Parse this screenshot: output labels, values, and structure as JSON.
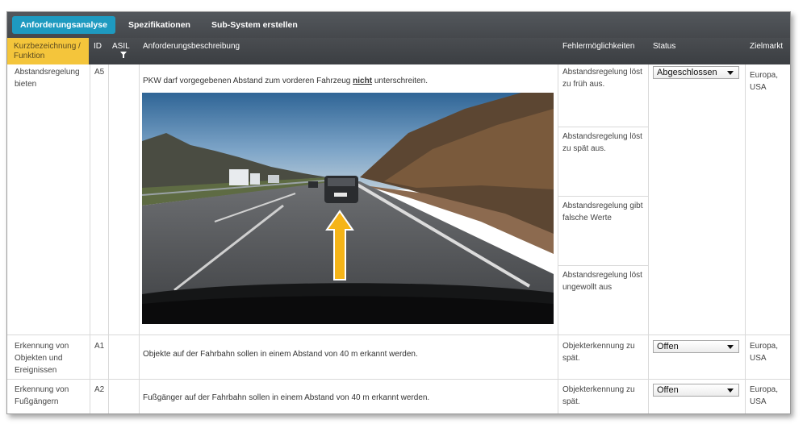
{
  "tabs": [
    {
      "label": "Anforderungsanalyse",
      "active": true
    },
    {
      "label": "Spezifikationen",
      "active": false
    },
    {
      "label": "Sub-System erstellen",
      "active": false
    }
  ],
  "columns": {
    "kurz": "Kurzbezeichnung / Funktion",
    "id": "ID",
    "asil": "ASIL",
    "beschreibung": "Anforderungsbeschreibung",
    "fehler": "Fehlermöglichkeiten",
    "status": "Status",
    "zielmarkt": "Zielmarkt"
  },
  "rows": [
    {
      "name": "Abstandsregelung bieten",
      "id": "A5",
      "asil": "",
      "desc_before": "PKW darf vorgegebenen Abstand zum vorderen Fahrzeug ",
      "desc_emph": "nicht",
      "desc_after": " unterschreiten.",
      "fehler": [
        "Abstandsregelung löst zu früh aus.",
        "Abstandsregelung löst zu spät aus.",
        "Abstandsregelung gibt falsche Werte",
        "Abstandsregelung löst ungewollt aus"
      ],
      "status": "Abgeschlossen",
      "zielmarkt": "Europa, USA"
    },
    {
      "name": "Erkennung von Objekten und Ereignissen",
      "id": "A1",
      "asil": "",
      "desc": "Objekte auf der Fahrbahn sollen in einem Abstand von 40 m erkannt werden.",
      "fehler": [
        "Objekterkennung zu spät."
      ],
      "status": "Offen",
      "zielmarkt": "Europa, USA"
    },
    {
      "name": "Erkennung von Fußgängern",
      "id": "A2",
      "asil": "",
      "desc": "Fußgänger auf der Fahrbahn sollen in einem Abstand von 40 m erkannt werden.",
      "fehler": [
        "Objekterkennung zu spät."
      ],
      "status": "Offen",
      "zielmarkt": "Europa, USA"
    }
  ],
  "image": {
    "subject": "highway-dashcam-photo",
    "arrow_color": "#f5b417"
  },
  "colors": {
    "tab_active": "#1e9ac0",
    "header_highlight": "#f4c53b",
    "header_bg": "#3b3e42"
  }
}
